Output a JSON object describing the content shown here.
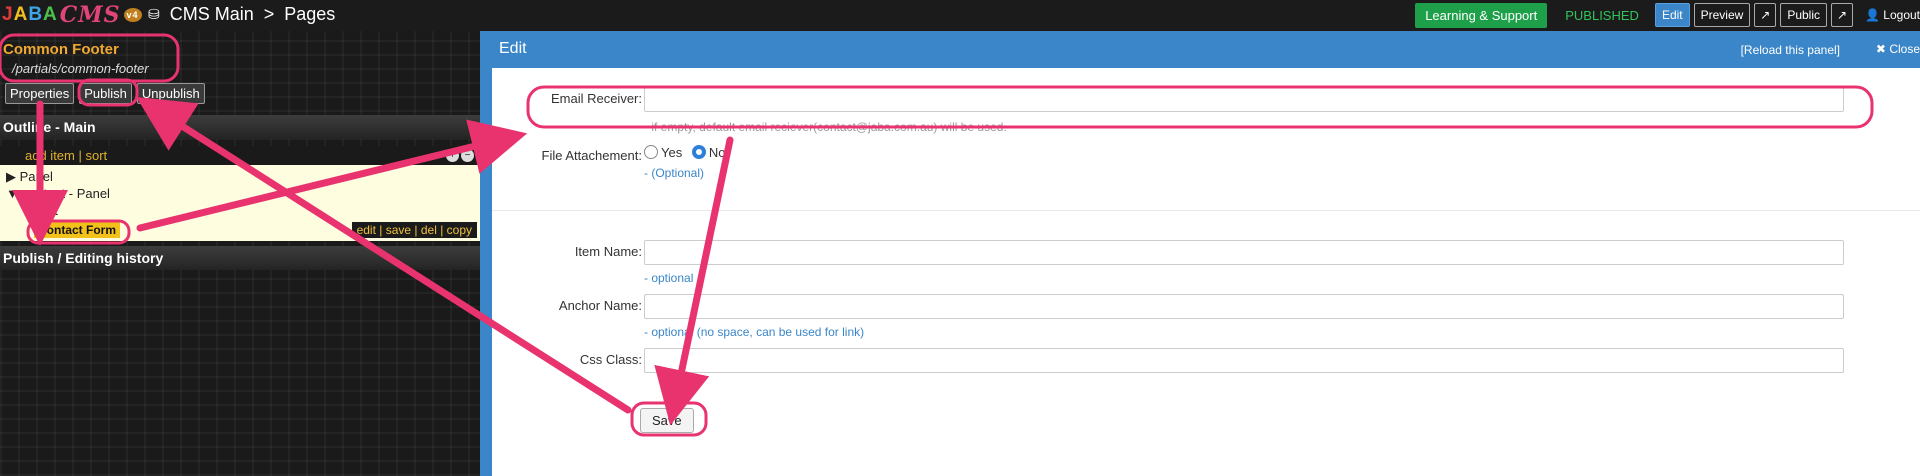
{
  "topbar": {
    "logo_parts": [
      "J",
      "A",
      "B",
      "A"
    ],
    "logo_cms": "CMS",
    "logo_version": "v4",
    "crumb_site": "CMS Main",
    "crumb_sep": ">",
    "crumb_page": "Pages",
    "learning_label": "Learning & Support",
    "status": "PUBLISHED",
    "edit_label": "Edit",
    "preview_label": "Preview",
    "public_label": "Public",
    "logout_label": "Logout"
  },
  "left": {
    "item_title": "Common Footer",
    "item_path": "/partials/common-footer",
    "buttons": {
      "properties": "Properties",
      "publish": "Publish",
      "unpublish": "Unpublish"
    },
    "outline_title": "Outline - Main",
    "add_item": "add item",
    "sort": "sort",
    "tree": {
      "row1": "Panel",
      "row2": "content - Panel",
      "row3": "Text",
      "active": "Contact Form",
      "actions": "edit | save | del | copy"
    },
    "history_title": "Publish / Editing history"
  },
  "edit": {
    "title": "Edit",
    "reload": "[Reload this panel]",
    "close": "Close",
    "email_label": "Email Receiver:",
    "email_value": "",
    "email_hint": "- if empty, default email reciever(contact@jaba.com.au) will be used.",
    "attach_label": "File Attachement:",
    "yes": "Yes",
    "no": "No",
    "attach_hint": "- (Optional)",
    "item_name_label": "Item Name:",
    "item_name_hint": "- optional",
    "anchor_label": "Anchor Name:",
    "anchor_hint": "- optional (no space, can be used for link)",
    "css_label": "Css Class:",
    "save": "Save"
  },
  "colors": {
    "accent": "#3a86c8",
    "annotation": "#e8336f",
    "published": "#31c45b"
  }
}
